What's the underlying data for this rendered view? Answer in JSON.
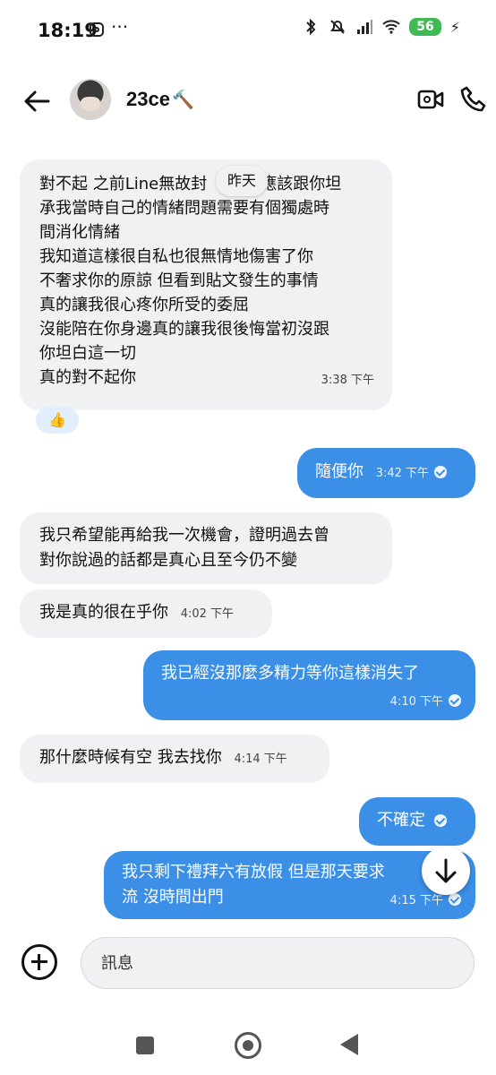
{
  "status_bar": {
    "time": "18:19",
    "more": "···",
    "battery": "56",
    "icons": [
      "instagram-icon",
      "bluetooth-icon",
      "mute-icon",
      "signal-icon",
      "wifi-icon",
      "battery-icon",
      "charging-icon"
    ]
  },
  "header": {
    "username": "23ce",
    "username_emoji": "🔨",
    "icons": [
      "back-arrow-icon",
      "video-call-icon",
      "phone-call-icon"
    ]
  },
  "day_separator": "昨天",
  "messages": [
    {
      "side": "in",
      "lines": [
        "對不起 之前Line無故封",
        "承我當時自己的情緒問題需要有個獨處時",
        "間消化情緒",
        "我知道這樣很自私也很無情地傷害了你",
        "不奢求你的原諒 但看到貼文發生的事情",
        "真的讓我很心疼你所受的委屈",
        "沒能陪在你身邊真的讓我很後悔當初沒跟",
        "你坦白這一切",
        "真的對不起你"
      ],
      "first_line_tail": "應該跟你坦",
      "time": "3:38 下午",
      "reaction": "👍"
    },
    {
      "side": "out",
      "text": "隨便你",
      "time": "3:42 下午"
    },
    {
      "side": "in",
      "lines": [
        "我只希望能再給我一次機會，證明過去曾",
        "對你說過的話都是真心且至今仍不變"
      ]
    },
    {
      "side": "in",
      "text": "我是真的很在乎你",
      "time": "4:02 下午"
    },
    {
      "side": "out",
      "text": "我已經沒那麼多精力等你這樣消失了",
      "time": "4:10 下午"
    },
    {
      "side": "in",
      "text": "那什麼時候有空 我去找你",
      "time": "4:14 下午"
    },
    {
      "side": "out",
      "text": "不確定"
    },
    {
      "side": "out",
      "lines": [
        "我只剩下禮拜六有放假 但是那天要求",
        "流 沒時間出門"
      ],
      "time": "4:15 下午"
    }
  ],
  "composer": {
    "placeholder": "訊息"
  },
  "colors": {
    "outgoing_bubble": "#3b8fe6",
    "incoming_bubble": "#f0f1f3",
    "battery": "#3fba54"
  }
}
